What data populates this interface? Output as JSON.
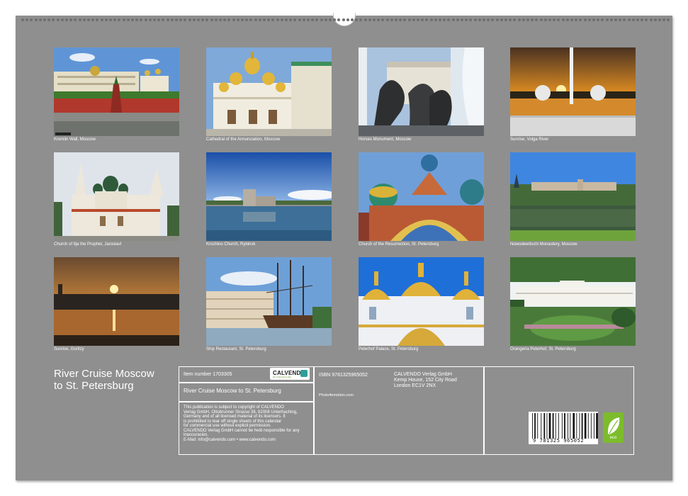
{
  "title": "River Cruise Moscow to St. Petersburg",
  "title_line1": "River Cruise Moscow",
  "title_line2": "to St. Petersburg",
  "photos": [
    {
      "caption": "Kremlin Wall, Moscow",
      "scene": "kremlin-photo"
    },
    {
      "caption": "Cathedral of the Annunciation, Moscow",
      "scene": "cathedral-photo"
    },
    {
      "caption": "Horses Monument, Moscow",
      "scene": "horses-photo"
    },
    {
      "caption": "Sunrise, Volga River",
      "scene": "sunrise-volga-photo"
    },
    {
      "caption": "Church of Ilja the Prophet, Jaroslavl",
      "scene": "church-ilja-photo"
    },
    {
      "caption": "Krochino Church, Rybinsk",
      "scene": "krochino-photo"
    },
    {
      "caption": "Church of the Resurrection, St. Petersburg",
      "scene": "resurrection-photo"
    },
    {
      "caption": "Nowodewitschi Monastery, Moscow",
      "scene": "monastery-photo"
    },
    {
      "caption": "Sunrise, Goritzy",
      "scene": "sunrise-goritzy-photo"
    },
    {
      "caption": "Ship Restaurant, St. Petersburg",
      "scene": "ship-photo"
    },
    {
      "caption": "Peterhof Palace, St. Petersburg",
      "scene": "peterhof-photo"
    },
    {
      "caption": "Orangeria Peterhof, St. Petersburg",
      "scene": "orangeria-photo"
    }
  ],
  "info": {
    "item_number": "Item number 1703305",
    "isbn": "ISBN 9781325965052",
    "calendar_title": "River Cruise Moscow to St. Petersburg",
    "photographer": "Photo4emotion.com",
    "publisher_line1": "CALVENDO Verlag GmbH",
    "publisher_line2": "Kemp House, 152 City Road",
    "publisher_line3": "London EC1V 2NX",
    "copyright_lines": [
      "This publication is subject to copyright of CALVENDO",
      "Verlag GmbH, Ottobrunner Strasse 38, 82008 Unterhaching,",
      "Germany and of all licensed material of its licensors. It",
      "is prohibited to tear off single sheets of this calendar",
      "for commercial use without explicit permission.",
      "CALVENDO Verlag GmbH cannot be held responsible for any",
      "inaccuracies.",
      "E-Mail: info@calvendo.com • www.calvendo.com"
    ],
    "barcode_digits": "9 781325 965052",
    "logo_name": "CALVENDO",
    "logo_sub": "Der Kalenderverlag",
    "eco_label": "eco"
  }
}
